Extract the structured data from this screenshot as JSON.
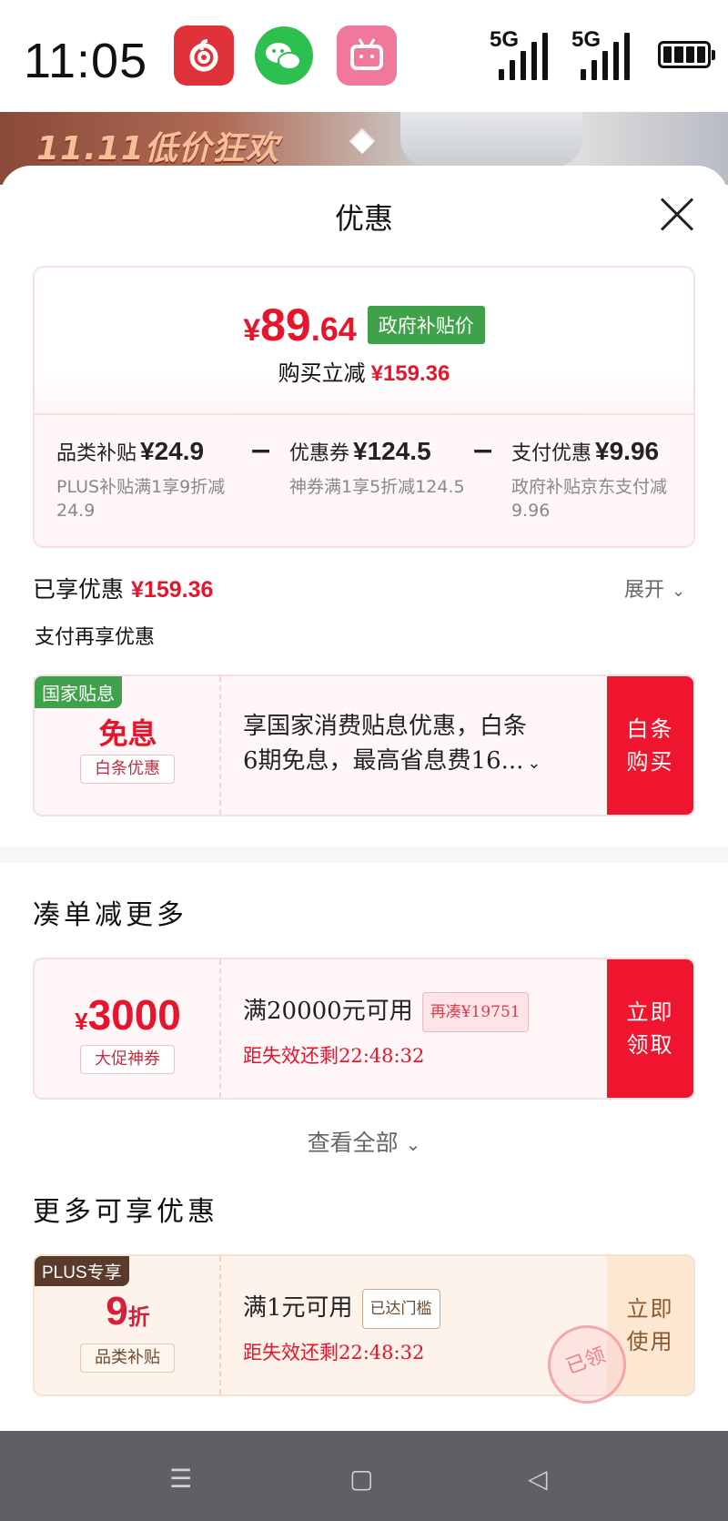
{
  "status_bar": {
    "time": "11:05",
    "apps": [
      "netease-music-icon",
      "wechat-icon",
      "bilibili-icon"
    ],
    "signal_1": "5G",
    "signal_2": "5G"
  },
  "background": {
    "promo_text": "11.11低价狂欢"
  },
  "sheet": {
    "title": "优惠",
    "summary": {
      "yen": "¥",
      "price_int": "89",
      "price_dec": ".64",
      "gov_badge": "政府补贴价",
      "reduce_label": "购买立减",
      "reduce_amount": "¥159.36",
      "breakdown": [
        {
          "label": "品类补贴",
          "value": "¥24.9",
          "desc": "PLUS补贴满1享9折减24.9"
        },
        {
          "label": "优惠券",
          "value": "¥124.5",
          "desc": "神券满1享5折减124.5"
        },
        {
          "label": "支付优惠",
          "value": "¥9.96",
          "desc": "政府补贴京东支付减9.96"
        }
      ],
      "minus": "−"
    },
    "enjoyed_label": "已享优惠",
    "enjoyed_amount": "¥159.36",
    "expand_label": "展开",
    "pay_more_label": "支付再享优惠",
    "baitiao": {
      "tag": "国家贴息",
      "main": "免息",
      "sub": "白条优惠",
      "desc_line1": "享国家消费贴息优惠，白条",
      "desc_line2": "6期免息，最高省息费16...",
      "action": "白条购买"
    },
    "section_more": "凑单减更多",
    "coupon": {
      "yen": "¥",
      "amount": "3000",
      "sub": "大促神券",
      "condition": "满20000元可用",
      "pill": "再凑¥19751",
      "expire": "距失效还剩22:48:32",
      "action": "立即领取"
    },
    "see_all": "查看全部",
    "section_enjoy": "更多可享优惠",
    "plus_coupon": {
      "tag": "PLUS专享",
      "amount": "9",
      "unit": "折",
      "sub": "品类补贴",
      "condition": "满1元可用",
      "pill": "已达门槛",
      "expire": "距失效还剩22:48:32",
      "action": "立即使用",
      "stamp": "已领"
    }
  },
  "nav_bar": {
    "menu": "☰",
    "home": "▢",
    "back": "◁"
  },
  "colors": {
    "accent_red": "#e8142c",
    "gov_green": "#3fa14a",
    "plus_brown": "#5a3a2a"
  }
}
